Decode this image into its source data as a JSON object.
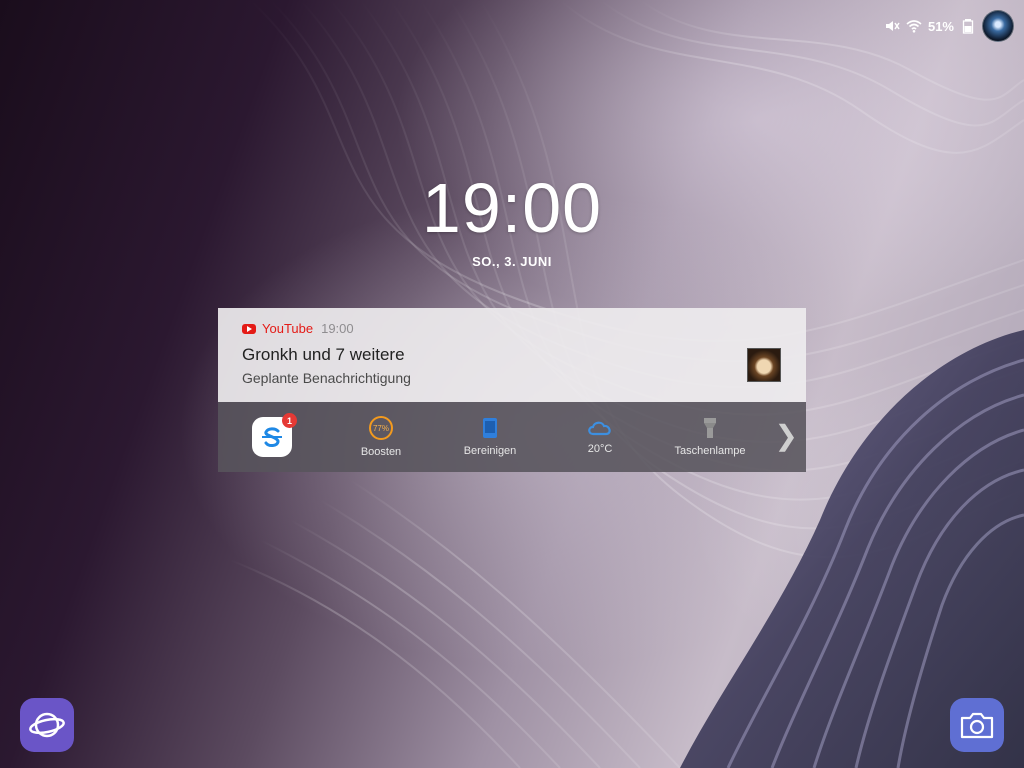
{
  "status_bar": {
    "icons": [
      "mute-icon",
      "wifi-icon",
      "battery-icon"
    ],
    "battery_percent": "51%"
  },
  "lock_screen": {
    "time": "19:00",
    "date": "SO., 3. JUNI"
  },
  "notification": {
    "app_name": "YouTube",
    "time": "19:00",
    "title": "Gronkh und 7 weitere",
    "text": "Geplante Benachrichtigung",
    "accent_color": "#e41b17"
  },
  "quick_actions": {
    "app_badge_count": "1",
    "boost_percent": "77%",
    "items": [
      {
        "label": "Boosten",
        "icon": "boost-gauge-icon"
      },
      {
        "label": "Bereinigen",
        "icon": "phone-clean-icon"
      },
      {
        "label": "20°C",
        "icon": "cloud-weather-icon"
      },
      {
        "label": "Taschenlampe",
        "icon": "flashlight-icon"
      }
    ],
    "more_icon": "chevron-right-icon"
  },
  "shortcuts": {
    "left": "internet-browser-icon",
    "right": "camera-icon"
  }
}
